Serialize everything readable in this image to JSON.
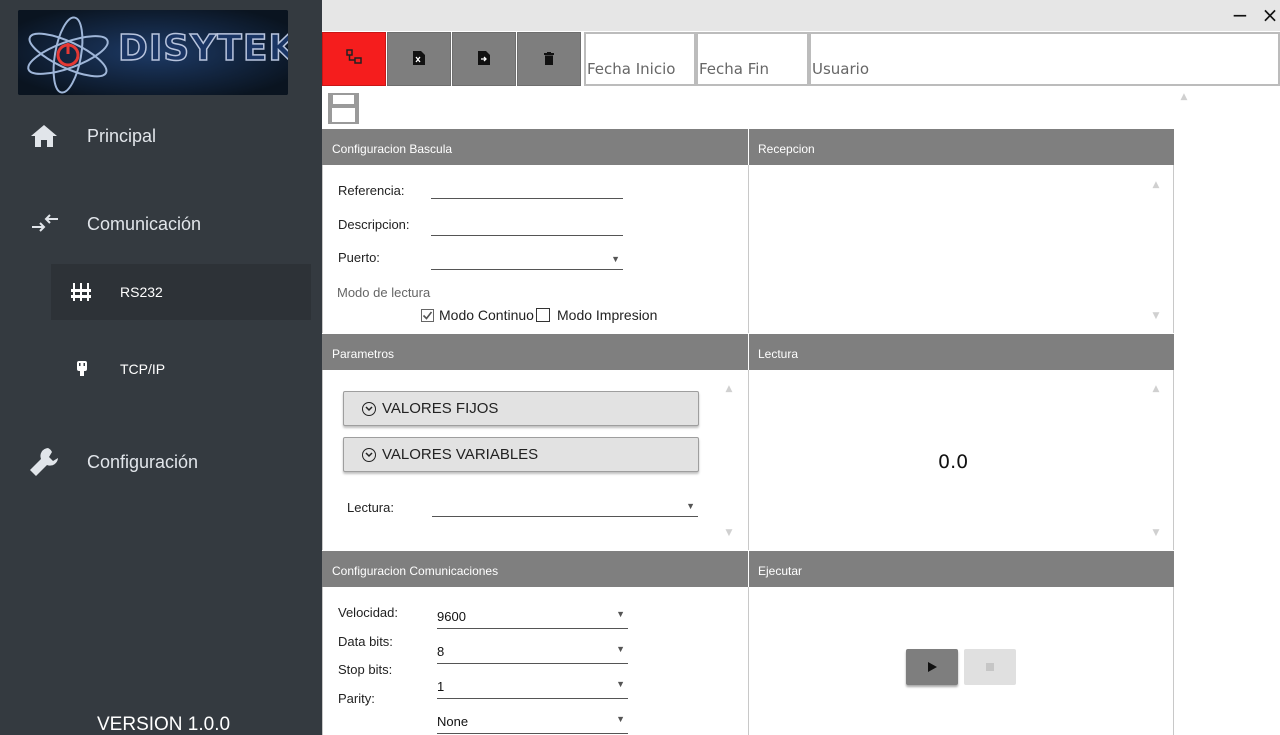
{
  "sidebar": {
    "logo_text": "DISYTEK",
    "items": [
      {
        "label": "Principal",
        "icon": "home-icon"
      },
      {
        "label": "Comunicación",
        "icon": "arrows-exchange-icon"
      },
      {
        "label": "Configuración",
        "icon": "wrench-icon"
      }
    ],
    "sub_items": [
      {
        "label": "RS232",
        "icon": "serial-port-icon",
        "active": true
      },
      {
        "label": "TCP/IP",
        "icon": "network-plug-icon",
        "active": false
      }
    ],
    "version": "VERSION 1.0.0"
  },
  "window": {
    "minimize": "−",
    "close": "×"
  },
  "toolbar": {
    "buttons": [
      {
        "icon": "disconnect-icon",
        "color": "#f51d1d"
      },
      {
        "icon": "excel-file-icon",
        "color": "#7e7e7e"
      },
      {
        "icon": "file-export-icon",
        "color": "#7e7e7e"
      },
      {
        "icon": "trash-icon",
        "color": "#7e7e7e"
      }
    ],
    "fecha_inicio_placeholder": "Fecha Inicio",
    "fecha_fin_placeholder": "Fecha Fin",
    "usuario_placeholder": "Usuario"
  },
  "panels": {
    "config_bascula": {
      "title": "Configuracion Bascula",
      "referencia_label": "Referencia:",
      "referencia_value": "",
      "descripcion_label": "Descripcion:",
      "descripcion_value": "",
      "puerto_label": "Puerto:",
      "puerto_value": "",
      "modo_label": "Modo de lectura",
      "modo_continuo_label": "Modo Continuo",
      "modo_continuo_checked": true,
      "modo_impresion_label": "Modo Impresion",
      "modo_impresion_checked": false
    },
    "recepcion": {
      "title": "Recepcion"
    },
    "parametros": {
      "title": "Parametros",
      "valores_fijos": "VALORES FIJOS",
      "valores_variables": "VALORES VARIABLES",
      "lectura_label": "Lectura:",
      "lectura_value": ""
    },
    "lectura": {
      "title": "Lectura",
      "value": "0.0"
    },
    "config_comunicaciones": {
      "title": "Configuracion Comunicaciones",
      "velocidad_label": "Velocidad:",
      "velocidad_value": "9600",
      "data_bits_label": "Data bits:",
      "data_bits_value": "8",
      "stop_bits_label": "Stop bits:",
      "stop_bits_value": "1",
      "parity_label": "Parity:",
      "parity_value": "None"
    },
    "ejecutar": {
      "title": "Ejecutar",
      "play_icon": "play-icon",
      "stop_icon": "stop-icon"
    }
  }
}
